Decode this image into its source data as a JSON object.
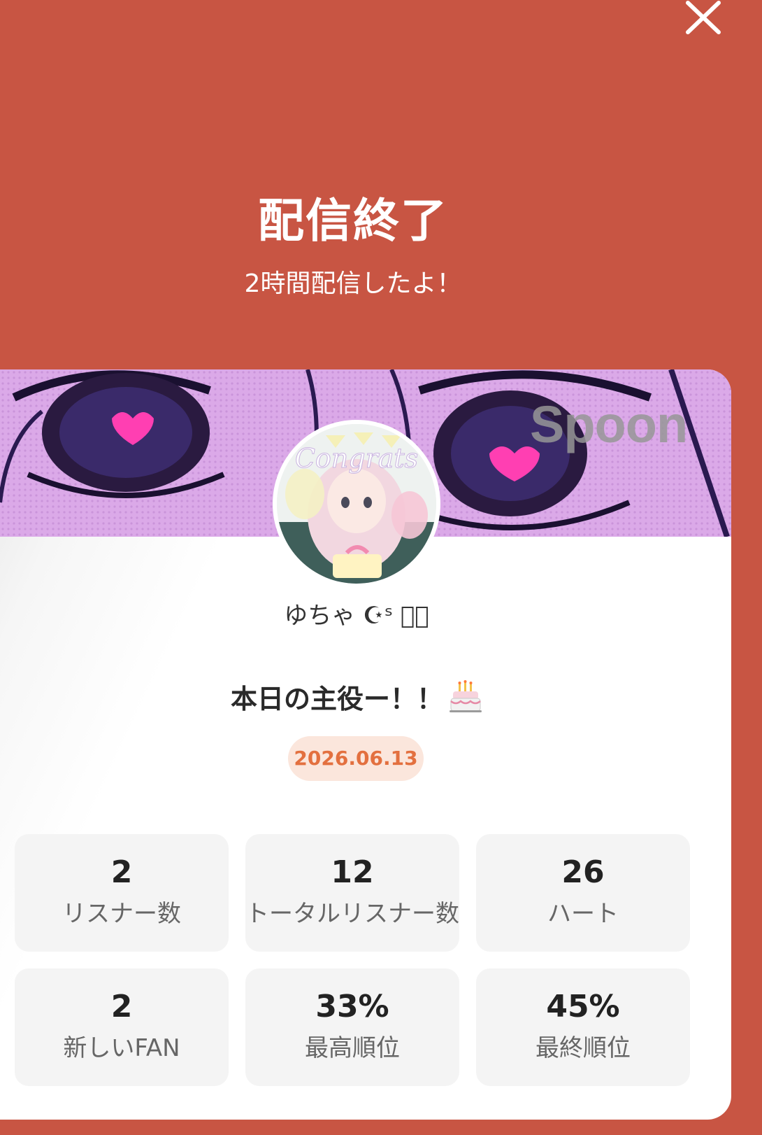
{
  "header": {
    "title": "配信終了",
    "subtitle": "2時間配信したよ！"
  },
  "banner": {
    "logo_text": "Spoon"
  },
  "profile": {
    "username": "ゆちゃ ☪ˢ ༄ͯ",
    "message": "本日の主役ー！！",
    "message_icon": "cake-icon",
    "avatar_text": "Congrats"
  },
  "date": "2026.06.13",
  "stats": [
    {
      "value": "2",
      "label": "リスナー数"
    },
    {
      "value": "12",
      "label": "トータルリスナー数"
    },
    {
      "value": "26",
      "label": "ハート"
    },
    {
      "value": "2",
      "label": "新しいFAN"
    },
    {
      "value": "33%",
      "label": "最高順位"
    },
    {
      "value": "45%",
      "label": "最終順位"
    }
  ],
  "colors": {
    "background": "#c85543",
    "date_text": "#e3703f",
    "date_pill": "#fbe6dc",
    "stat_tile": "#f4f4f4"
  }
}
